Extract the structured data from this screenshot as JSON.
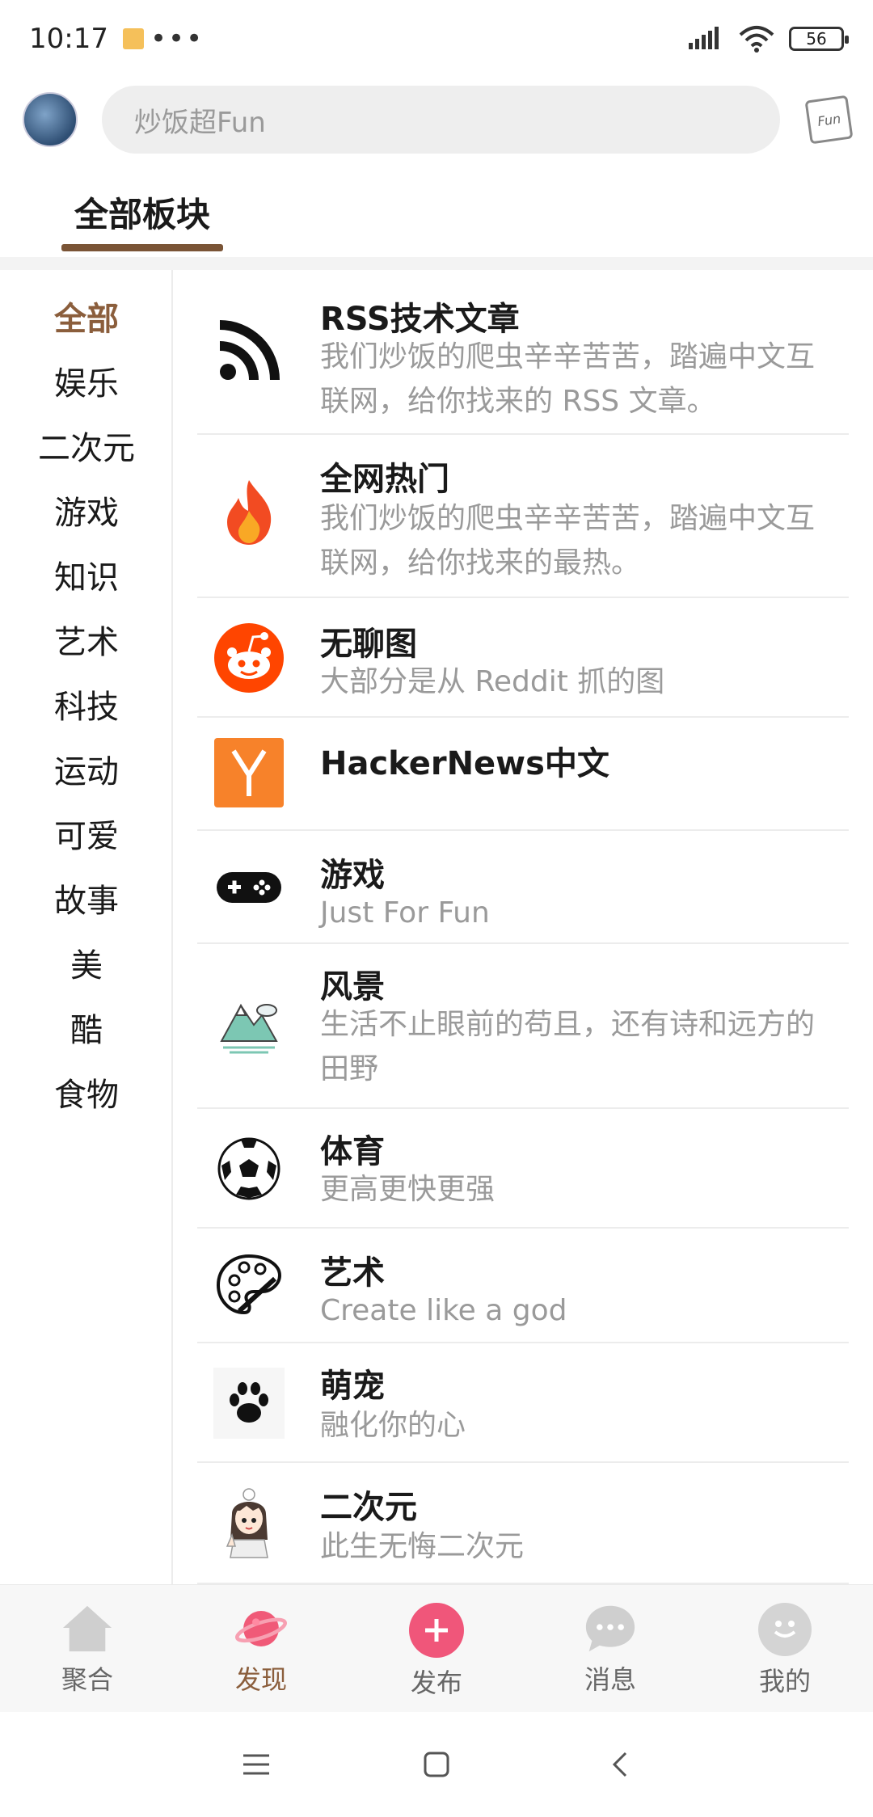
{
  "status_bar": {
    "time": "10:17",
    "dots": "•••",
    "battery": "56"
  },
  "header": {
    "search_placeholder": "炒饭超Fun",
    "logo_text": "Fun"
  },
  "tabs": {
    "active_label": "全部板块"
  },
  "categories": [
    "全部",
    "娱乐",
    "二次元",
    "游戏",
    "知识",
    "艺术",
    "科技",
    "运动",
    "可爱",
    "故事",
    "美",
    "酷",
    "食物"
  ],
  "active_category": "全部",
  "boards": [
    {
      "title": "RSS技术文章",
      "desc": "我们炒饭的爬虫辛辛苦苦，踏遍中文互联网，给你找来的 RSS 文章。",
      "icon": "rss-icon"
    },
    {
      "title": "全网热门",
      "desc": "我们炒饭的爬虫辛辛苦苦，踏遍中文互联网，给你找来的最热。",
      "icon": "fire-icon"
    },
    {
      "title": "无聊图",
      "desc": "大部分是从 Reddit 抓的图",
      "icon": "reddit-icon"
    },
    {
      "title": "HackerNews中文",
      "desc": "",
      "icon": "hackernews-icon"
    },
    {
      "title": "游戏",
      "desc": "Just For Fun",
      "icon": "gamepad-icon"
    },
    {
      "title": "风景",
      "desc": "生活不止眼前的苟且，还有诗和远方的田野",
      "icon": "mountain-icon"
    },
    {
      "title": "体育",
      "desc": "更高更快更强",
      "icon": "soccer-ball-icon"
    },
    {
      "title": "艺术",
      "desc": "Create like a god",
      "icon": "palette-icon"
    },
    {
      "title": "萌宠",
      "desc": "融化你的心",
      "icon": "paw-icon"
    },
    {
      "title": "二次元",
      "desc": "此生无悔二次元",
      "icon": "anime-girl-icon"
    }
  ],
  "bottom_nav": [
    {
      "label": "聚合",
      "icon": "home-icon"
    },
    {
      "label": "发现",
      "icon": "planet-icon"
    },
    {
      "label": "发布",
      "icon": "plus-icon"
    },
    {
      "label": "消息",
      "icon": "chat-bubble-icon"
    },
    {
      "label": "我的",
      "icon": "smile-icon"
    }
  ],
  "colors": {
    "accent": "#8b5e3c",
    "publish": "#f0567a",
    "planet": "#f05a78"
  }
}
